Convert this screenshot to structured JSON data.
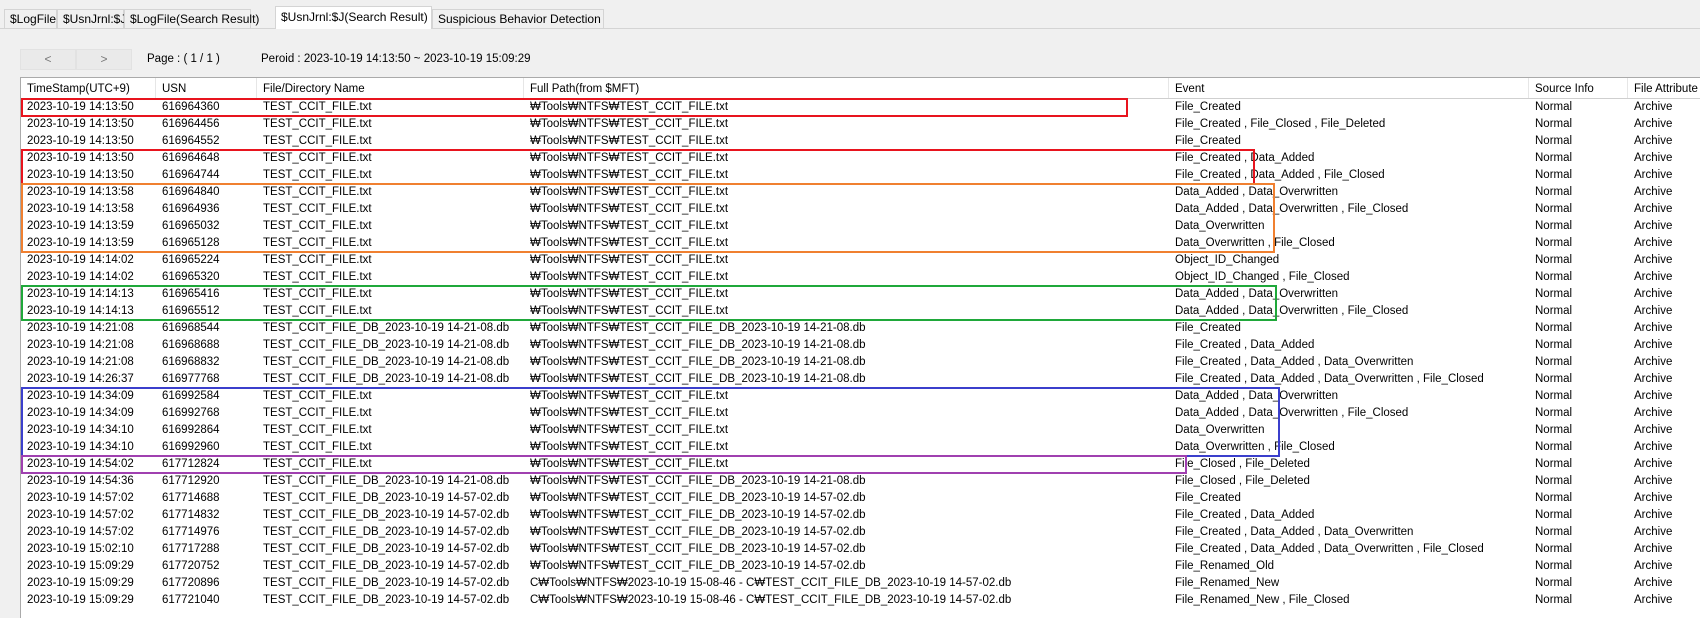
{
  "tabs": [
    {
      "label": "$LogFile",
      "active": false
    },
    {
      "label": "$UsnJrnl:$J",
      "active": false
    },
    {
      "label": "$LogFile(Search Result)",
      "active": false
    },
    {
      "label": "$UsnJrnl:$J(Search Result)",
      "active": true
    },
    {
      "label": "Suspicious Behavior Detection",
      "active": false
    }
  ],
  "toolbar": {
    "prev_label": "<",
    "next_label": ">",
    "page_text": "Page : ( 1 / 1 )",
    "period_text": "Peroid :  2023-10-19 14:13:50 ~ 2023-10-19 15:09:29"
  },
  "columns": [
    "TimeStamp(UTC+9)",
    "USN",
    "File/Directory Name",
    "Full Path(from $MFT)",
    "Event",
    "Source Info",
    "File Attribute"
  ],
  "rows": [
    [
      "2023-10-19 14:13:50",
      "616964360",
      "TEST_CCIT_FILE.txt",
      "₩Tools₩NTFS₩TEST_CCIT_FILE.txt",
      "File_Created",
      "Normal",
      "Archive"
    ],
    [
      "2023-10-19 14:13:50",
      "616964456",
      "TEST_CCIT_FILE.txt",
      "₩Tools₩NTFS₩TEST_CCIT_FILE.txt",
      "File_Created , File_Closed , File_Deleted",
      "Normal",
      "Archive"
    ],
    [
      "2023-10-19 14:13:50",
      "616964552",
      "TEST_CCIT_FILE.txt",
      "₩Tools₩NTFS₩TEST_CCIT_FILE.txt",
      "File_Created",
      "Normal",
      "Archive"
    ],
    [
      "2023-10-19 14:13:50",
      "616964648",
      "TEST_CCIT_FILE.txt",
      "₩Tools₩NTFS₩TEST_CCIT_FILE.txt",
      "File_Created , Data_Added",
      "Normal",
      "Archive"
    ],
    [
      "2023-10-19 14:13:50",
      "616964744",
      "TEST_CCIT_FILE.txt",
      "₩Tools₩NTFS₩TEST_CCIT_FILE.txt",
      "File_Created , Data_Added , File_Closed",
      "Normal",
      "Archive"
    ],
    [
      "2023-10-19 14:13:58",
      "616964840",
      "TEST_CCIT_FILE.txt",
      "₩Tools₩NTFS₩TEST_CCIT_FILE.txt",
      "Data_Added , Data_Overwritten",
      "Normal",
      "Archive"
    ],
    [
      "2023-10-19 14:13:58",
      "616964936",
      "TEST_CCIT_FILE.txt",
      "₩Tools₩NTFS₩TEST_CCIT_FILE.txt",
      "Data_Added , Data_Overwritten , File_Closed",
      "Normal",
      "Archive"
    ],
    [
      "2023-10-19 14:13:59",
      "616965032",
      "TEST_CCIT_FILE.txt",
      "₩Tools₩NTFS₩TEST_CCIT_FILE.txt",
      "Data_Overwritten",
      "Normal",
      "Archive"
    ],
    [
      "2023-10-19 14:13:59",
      "616965128",
      "TEST_CCIT_FILE.txt",
      "₩Tools₩NTFS₩TEST_CCIT_FILE.txt",
      "Data_Overwritten , File_Closed",
      "Normal",
      "Archive"
    ],
    [
      "2023-10-19 14:14:02",
      "616965224",
      "TEST_CCIT_FILE.txt",
      "₩Tools₩NTFS₩TEST_CCIT_FILE.txt",
      "Object_ID_Changed",
      "Normal",
      "Archive"
    ],
    [
      "2023-10-19 14:14:02",
      "616965320",
      "TEST_CCIT_FILE.txt",
      "₩Tools₩NTFS₩TEST_CCIT_FILE.txt",
      "Object_ID_Changed , File_Closed",
      "Normal",
      "Archive"
    ],
    [
      "2023-10-19 14:14:13",
      "616965416",
      "TEST_CCIT_FILE.txt",
      "₩Tools₩NTFS₩TEST_CCIT_FILE.txt",
      "Data_Added , Data_Overwritten",
      "Normal",
      "Archive"
    ],
    [
      "2023-10-19 14:14:13",
      "616965512",
      "TEST_CCIT_FILE.txt",
      "₩Tools₩NTFS₩TEST_CCIT_FILE.txt",
      "Data_Added , Data_Overwritten , File_Closed",
      "Normal",
      "Archive"
    ],
    [
      "2023-10-19 14:21:08",
      "616968544",
      "TEST_CCIT_FILE_DB_2023-10-19 14-21-08.db",
      "₩Tools₩NTFS₩TEST_CCIT_FILE_DB_2023-10-19 14-21-08.db",
      "File_Created",
      "Normal",
      "Archive"
    ],
    [
      "2023-10-19 14:21:08",
      "616968688",
      "TEST_CCIT_FILE_DB_2023-10-19 14-21-08.db",
      "₩Tools₩NTFS₩TEST_CCIT_FILE_DB_2023-10-19 14-21-08.db",
      "File_Created , Data_Added",
      "Normal",
      "Archive"
    ],
    [
      "2023-10-19 14:21:08",
      "616968832",
      "TEST_CCIT_FILE_DB_2023-10-19 14-21-08.db",
      "₩Tools₩NTFS₩TEST_CCIT_FILE_DB_2023-10-19 14-21-08.db",
      "File_Created , Data_Added , Data_Overwritten",
      "Normal",
      "Archive"
    ],
    [
      "2023-10-19 14:26:37",
      "616977768",
      "TEST_CCIT_FILE_DB_2023-10-19 14-21-08.db",
      "₩Tools₩NTFS₩TEST_CCIT_FILE_DB_2023-10-19 14-21-08.db",
      "File_Created , Data_Added , Data_Overwritten , File_Closed",
      "Normal",
      "Archive"
    ],
    [
      "2023-10-19 14:34:09",
      "616992584",
      "TEST_CCIT_FILE.txt",
      "₩Tools₩NTFS₩TEST_CCIT_FILE.txt",
      "Data_Added , Data_Overwritten",
      "Normal",
      "Archive"
    ],
    [
      "2023-10-19 14:34:09",
      "616992768",
      "TEST_CCIT_FILE.txt",
      "₩Tools₩NTFS₩TEST_CCIT_FILE.txt",
      "Data_Added , Data_Overwritten , File_Closed",
      "Normal",
      "Archive"
    ],
    [
      "2023-10-19 14:34:10",
      "616992864",
      "TEST_CCIT_FILE.txt",
      "₩Tools₩NTFS₩TEST_CCIT_FILE.txt",
      "Data_Overwritten",
      "Normal",
      "Archive"
    ],
    [
      "2023-10-19 14:34:10",
      "616992960",
      "TEST_CCIT_FILE.txt",
      "₩Tools₩NTFS₩TEST_CCIT_FILE.txt",
      "Data_Overwritten , File_Closed",
      "Normal",
      "Archive"
    ],
    [
      "2023-10-19 14:54:02",
      "617712824",
      "TEST_CCIT_FILE.txt",
      "₩Tools₩NTFS₩TEST_CCIT_FILE.txt",
      "File_Closed , File_Deleted",
      "Normal",
      "Archive"
    ],
    [
      "2023-10-19 14:54:36",
      "617712920",
      "TEST_CCIT_FILE_DB_2023-10-19 14-21-08.db",
      "₩Tools₩NTFS₩TEST_CCIT_FILE_DB_2023-10-19 14-21-08.db",
      "File_Closed , File_Deleted",
      "Normal",
      "Archive"
    ],
    [
      "2023-10-19 14:57:02",
      "617714688",
      "TEST_CCIT_FILE_DB_2023-10-19 14-57-02.db",
      "₩Tools₩NTFS₩TEST_CCIT_FILE_DB_2023-10-19 14-57-02.db",
      "File_Created",
      "Normal",
      "Archive"
    ],
    [
      "2023-10-19 14:57:02",
      "617714832",
      "TEST_CCIT_FILE_DB_2023-10-19 14-57-02.db",
      "₩Tools₩NTFS₩TEST_CCIT_FILE_DB_2023-10-19 14-57-02.db",
      "File_Created , Data_Added",
      "Normal",
      "Archive"
    ],
    [
      "2023-10-19 14:57:02",
      "617714976",
      "TEST_CCIT_FILE_DB_2023-10-19 14-57-02.db",
      "₩Tools₩NTFS₩TEST_CCIT_FILE_DB_2023-10-19 14-57-02.db",
      "File_Created , Data_Added , Data_Overwritten",
      "Normal",
      "Archive"
    ],
    [
      "2023-10-19 15:02:10",
      "617717288",
      "TEST_CCIT_FILE_DB_2023-10-19 14-57-02.db",
      "₩Tools₩NTFS₩TEST_CCIT_FILE_DB_2023-10-19 14-57-02.db",
      "File_Created , Data_Added , Data_Overwritten , File_Closed",
      "Normal",
      "Archive"
    ],
    [
      "2023-10-19 15:09:29",
      "617720752",
      "TEST_CCIT_FILE_DB_2023-10-19 14-57-02.db",
      "₩Tools₩NTFS₩TEST_CCIT_FILE_DB_2023-10-19 14-57-02.db",
      "File_Renamed_Old",
      "Normal",
      "Archive"
    ],
    [
      "2023-10-19 15:09:29",
      "617720896",
      "TEST_CCIT_FILE_DB_2023-10-19 14-57-02.db",
      "C₩Tools₩NTFS₩2023-10-19 15-08-46 - C₩TEST_CCIT_FILE_DB_2023-10-19 14-57-02.db",
      "File_Renamed_New",
      "Normal",
      "Archive"
    ],
    [
      "2023-10-19 15:09:29",
      "617721040",
      "TEST_CCIT_FILE_DB_2023-10-19 14-57-02.db",
      "C₩Tools₩NTFS₩2023-10-19 15-08-46 - C₩TEST_CCIT_FILE_DB_2023-10-19 14-57-02.db",
      "File_Renamed_New , File_Closed",
      "Normal",
      "Archive"
    ]
  ],
  "highlights": [
    {
      "rows": [
        0,
        0
      ],
      "color": "#e8141e"
    },
    {
      "rows": [
        3,
        4
      ],
      "color": "#e8141e"
    },
    {
      "rows": [
        5,
        8
      ],
      "color": "#f08030"
    },
    {
      "rows": [
        11,
        12
      ],
      "color": "#1fa83a"
    },
    {
      "rows": [
        17,
        20
      ],
      "color": "#3b3fcc"
    },
    {
      "rows": [
        21,
        21
      ],
      "color": "#a040b0"
    }
  ]
}
